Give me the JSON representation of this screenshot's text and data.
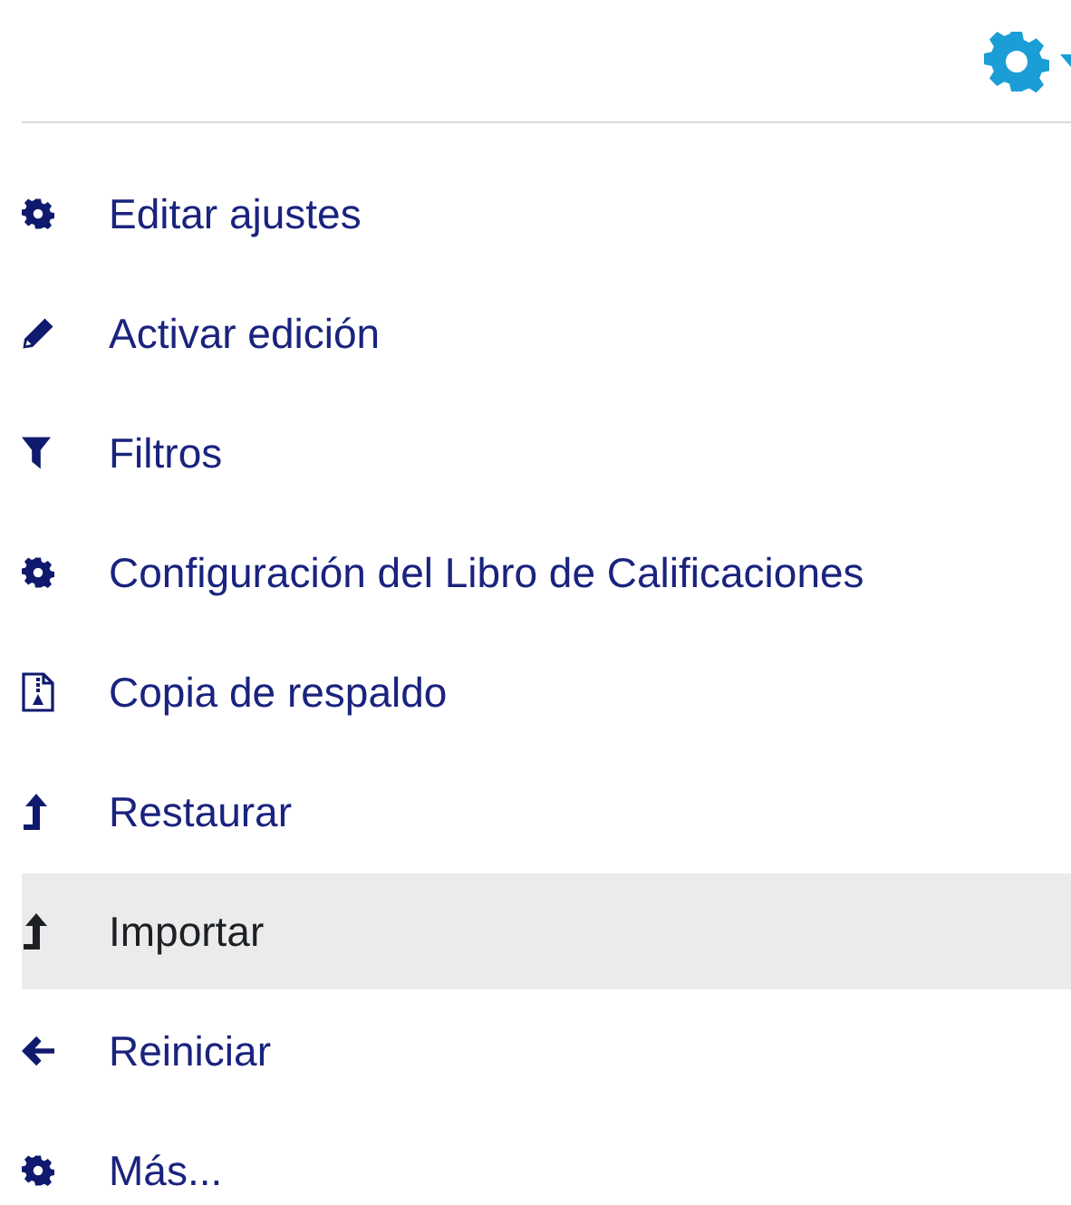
{
  "items": [
    {
      "label": "Editar ajustes",
      "kind": "gear",
      "selected": false
    },
    {
      "label": "Activar edición",
      "kind": "pencil",
      "selected": false
    },
    {
      "label": "Filtros",
      "kind": "filter",
      "selected": false
    },
    {
      "label": "Configuración del Libro de Calificaciones",
      "kind": "gear",
      "selected": false
    },
    {
      "label": "Copia de respaldo",
      "kind": "file",
      "selected": false
    },
    {
      "label": "Restaurar",
      "kind": "up",
      "selected": false
    },
    {
      "label": "Importar",
      "kind": "up",
      "selected": true
    },
    {
      "label": "Reiniciar",
      "kind": "back",
      "selected": false
    },
    {
      "label": "Más...",
      "kind": "gear",
      "selected": false
    }
  ]
}
